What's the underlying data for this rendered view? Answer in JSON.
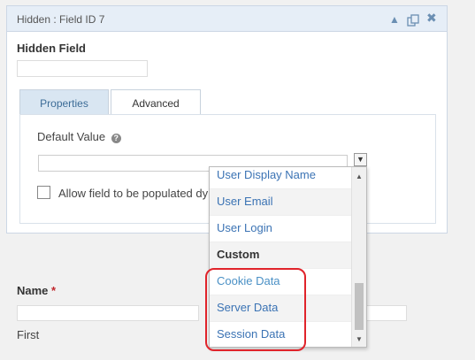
{
  "panel": {
    "title": "Hidden : Field ID 7",
    "field_label": "Hidden Field",
    "tabs": [
      {
        "label": "Properties"
      },
      {
        "label": "Advanced"
      }
    ],
    "advanced": {
      "default_value_label": "Default Value",
      "help_icon": "?",
      "checkbox_label": "Allow field to be populated dynamically"
    }
  },
  "dropdown": {
    "items": [
      {
        "label": "User Display Name",
        "type": "link"
      },
      {
        "label": "User Email",
        "type": "link"
      },
      {
        "label": "User Login",
        "type": "link"
      },
      {
        "label": "Custom",
        "type": "group"
      },
      {
        "label": "Cookie Data",
        "type": "link"
      },
      {
        "label": "Server Data",
        "type": "link"
      },
      {
        "label": "Session Data",
        "type": "link"
      }
    ]
  },
  "name_field": {
    "label": "Name",
    "required_mark": "*",
    "first_label": "First"
  },
  "colors": {
    "highlight_border": "#e0232a",
    "link": "#3b73b4",
    "header_bg": "#e6eef7"
  }
}
